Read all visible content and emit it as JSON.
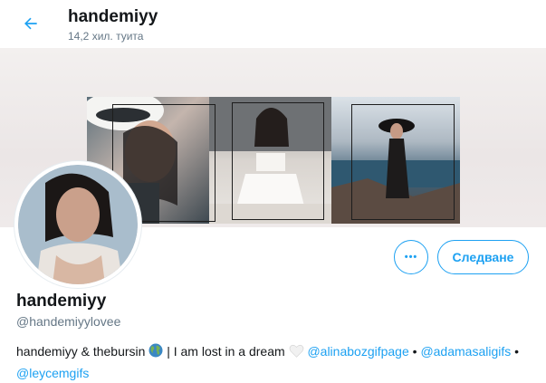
{
  "header": {
    "title": "handemiyy",
    "subtitle": "14,2 хил. туита"
  },
  "profile": {
    "name": "handemiyy",
    "handle": "@handemiyylovee",
    "bio": {
      "text1": "handemiyy & thebursin",
      "text2": "| I am lost in a dream",
      "link1": "@alinabozgifpage",
      "sep1": "•",
      "link2": "@adamasaligifs",
      "sep2": "•",
      "link3": "@leycemgifs"
    }
  },
  "actions": {
    "follow_label": "Следване",
    "more_label": "•••"
  },
  "icons": {
    "back": "arrow-left-icon",
    "globe": "globe-emoji-icon",
    "heart": "white-heart-emoji-icon"
  },
  "colors": {
    "accent": "#1da1f2",
    "text": "#14171a",
    "secondary": "#657786"
  }
}
